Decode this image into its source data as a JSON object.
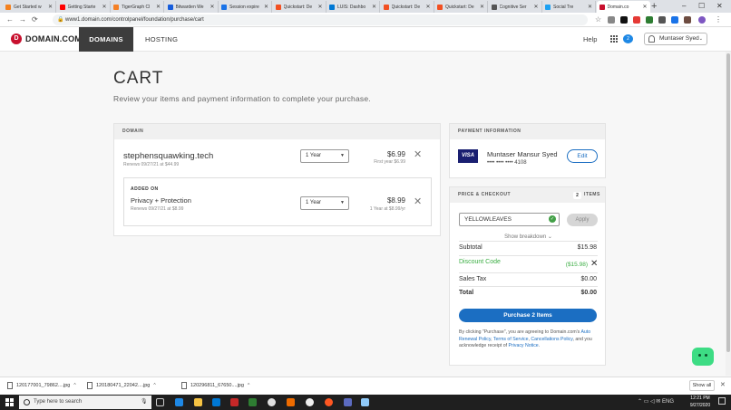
{
  "browser": {
    "tabs": [
      {
        "label": "Get Started w",
        "color": "#f4811f"
      },
      {
        "label": "Getting Starte",
        "color": "#ff0000"
      },
      {
        "label": "TigerGraph Cl",
        "color": "#f58025"
      },
      {
        "label": "Bitwarden We",
        "color": "#175ddc"
      },
      {
        "label": "Session expire",
        "color": "#1a73e8"
      },
      {
        "label": "Quickstart: De",
        "color": "#f25022"
      },
      {
        "label": "LUIS: Dashbo",
        "color": "#0078d4"
      },
      {
        "label": "Quickstart: De",
        "color": "#f25022"
      },
      {
        "label": "Quickstart: De",
        "color": "#f25022"
      },
      {
        "label": "Cognitive Ser",
        "color": "#555555"
      },
      {
        "label": "Social Tre",
        "color": "#1da1f2"
      },
      {
        "label": "Domain.co",
        "color": "#c8102e"
      }
    ],
    "new_tab": "+",
    "url": "www1.domain.com/controlpanel/foundation/purchase/cart"
  },
  "site": {
    "logo_letter": "D",
    "logo_text": "DOMAIN.COM",
    "nav": {
      "domains": "DOMAINS",
      "hosting": "HOSTING"
    },
    "help": "Help",
    "cart_count": "2",
    "account": "Muntaser Syed"
  },
  "page": {
    "title": "CART",
    "subtitle": "Review your items and payment information to complete your purchase."
  },
  "domain_panel": {
    "header": "DOMAIN",
    "name": "stephensquawking.tech",
    "renew": "Renews 09/27/21 at $44.99",
    "term": "1 Year",
    "price": "$6.99",
    "first_year": "First year $6.99",
    "addon": {
      "label": "ADDED ON",
      "name": "Privacy + Protection",
      "renew": "Renews 09/27/21 at $8.99",
      "term": "1 Year",
      "price": "$8.99",
      "per_year": "1 Year at $8.99/yr"
    }
  },
  "payment": {
    "header": "PAYMENT INFORMATION",
    "card_brand": "VISA",
    "card_name": "Muntaser Mansur Syed",
    "card_number": "•••• •••• •••• 4108",
    "edit": "Edit"
  },
  "checkout": {
    "header": "PRICE & CHECKOUT",
    "items_count": "2",
    "items_word": "ITEMS",
    "promo_code": "YELLOWLEAVES",
    "apply": "Apply",
    "breakdown": "Show breakdown ⌄",
    "subtotal_label": "Subtotal",
    "subtotal": "$15.98",
    "discount_label": "Discount Code",
    "discount": "($15.98)",
    "tax_label": "Sales Tax",
    "tax": "$0.00",
    "total_label": "Total",
    "total": "$0.00",
    "purchase": "Purchase 2 Items",
    "legal_1": "By clicking \"Purchase\", you are agreeing to Domain.com's ",
    "legal_link_1": "Auto Renewal Policy",
    "legal_2": ", ",
    "legal_link_2": "Terms of Service",
    "legal_3": ", ",
    "legal_link_3": "Cancellations Policy",
    "legal_4": ", and you acknowledge receipt of ",
    "legal_link_4": "Privacy Notice",
    "legal_5": "."
  },
  "downloads": {
    "items": [
      "120177001_79862....jpg",
      "120180471_22042....jpg",
      "120296811_67650....jpg"
    ],
    "show_all": "Show all"
  },
  "taskbar": {
    "search_placeholder": "Type here to search",
    "time": "12:21 PM",
    "date": "9/27/2020"
  }
}
